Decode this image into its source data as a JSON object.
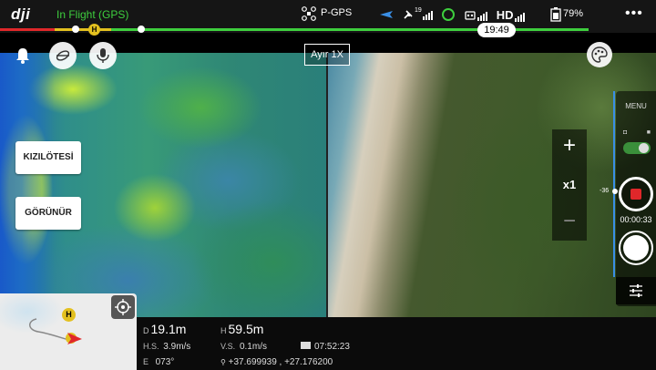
{
  "app": {
    "logo": "dji"
  },
  "status_bar": {
    "flight_status": "In Flight (GPS)",
    "positioning": "P-GPS",
    "gps_sats": "19",
    "video_link": "HD",
    "battery": "79%",
    "more_icon": "more-dots-icon"
  },
  "timeline": {
    "home_marker": "H",
    "remaining_time": "19:49"
  },
  "toolbar": {
    "lens_label": "Ayır 1X"
  },
  "left_buttons": {
    "infrared": "KIZILÖTESİ",
    "visible": "GÖRÜNÜR"
  },
  "zoom": {
    "plus": "+",
    "level": "x1",
    "minus": "−"
  },
  "right_panel": {
    "menu": "MENU",
    "ev_value": "-36",
    "record_time": "00:00:33"
  },
  "map": {
    "home_marker": "H"
  },
  "telemetry": {
    "distance_label": "D",
    "distance": "19.1m",
    "height_label": "H",
    "height": "59.5m",
    "hs_label": "H.S.",
    "hs": "3.9m/s",
    "vs_label": "V.S.",
    "vs": "0.1m/s",
    "flight_time": "07:52:23",
    "heading_label": "E",
    "heading": "073°",
    "coordinates": "+37.699939 , +27.176200"
  },
  "colors": {
    "accent_green": "#3ecf3e",
    "record_red": "#e0272a",
    "home_yellow": "#e3c01f",
    "ev_blue": "#3a8fe6"
  }
}
